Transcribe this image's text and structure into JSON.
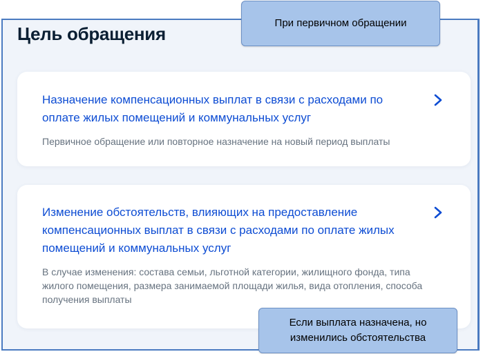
{
  "page": {
    "title": "Цель обращения"
  },
  "options": [
    {
      "title": "Назначение компенсационных выплат в связи с расходами по оплате жилых помещений и коммунальных услуг",
      "description": "Первичное обращение или повторное назначение на новый период выплаты",
      "icon": "chevron-right-icon"
    },
    {
      "title": "Изменение обстоятельств, влияющих на предоставление компенсационных выплат в связи с расходами по оплате жилых помещений и коммунальных услуг",
      "description": "В случае изменения: состава семьи, льготной категории, жилищного фонда, типа жилого помещения, размера занимаемой площади жилья, вида отопления, способа получения выплаты",
      "icon": "chevron-right-icon"
    }
  ],
  "callouts": {
    "top": "При первичном обращении",
    "bottom_line1": "Если выплата назначена, но",
    "bottom_line2": "изменились обстоятельства"
  },
  "colors": {
    "link": "#0d4cd3",
    "heading": "#0b1f33",
    "muted": "#66727f",
    "background": "#f0f4fa",
    "callout": "#a7c4ea",
    "frame_border": "#4a7ac0"
  }
}
